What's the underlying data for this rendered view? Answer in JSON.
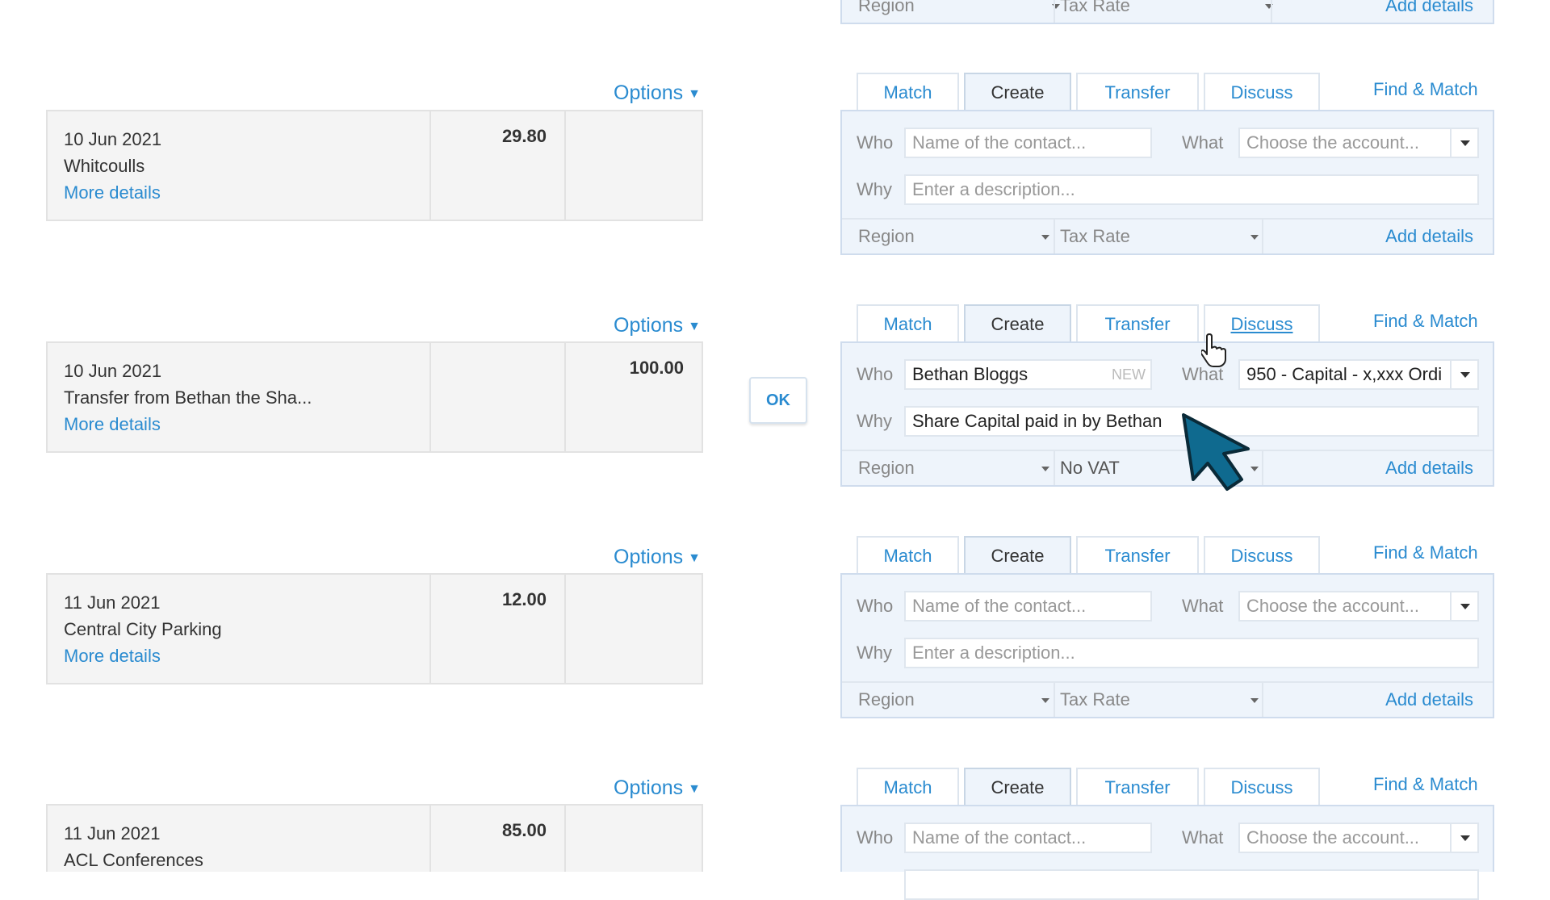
{
  "common": {
    "options_label": "Options",
    "more_details": "More details",
    "tabs": {
      "match": "Match",
      "create": "Create",
      "transfer": "Transfer",
      "discuss": "Discuss"
    },
    "find_match": "Find & Match",
    "who_label": "Who",
    "what_label": "What",
    "why_label": "Why",
    "who_placeholder": "Name of the contact...",
    "what_placeholder": "Choose the account...",
    "why_placeholder": "Enter a description...",
    "region_label": "Region",
    "tax_rate_label": "Tax Rate",
    "add_details": "Add details"
  },
  "top_partial": {
    "region": "Region",
    "tax": "Tax Rate",
    "add_details": "Add details"
  },
  "rows": [
    {
      "date": "10 Jun 2021",
      "payee": "Whitcoulls",
      "spent": "29.80",
      "received": ""
    },
    {
      "date": "10 Jun 2021",
      "payee": "Transfer from Bethan the Sha...",
      "spent": "",
      "received": "100.00",
      "who": "Bethan Bloggs",
      "who_tag": "NEW",
      "what": "950 - Capital - x,xxx Ordi",
      "why": "Share Capital paid in by Bethan",
      "tax": "No VAT"
    },
    {
      "date": "11 Jun 2021",
      "payee": "Central City Parking",
      "spent": "12.00",
      "received": ""
    },
    {
      "date": "11 Jun 2021",
      "payee": "ACL Conferences",
      "spent": "85.00",
      "received": ""
    }
  ],
  "ok_label": "OK",
  "colors": {
    "link": "#2a8bd0",
    "panel_bg": "#eef4fb",
    "cursor": "#0f6a8f"
  }
}
